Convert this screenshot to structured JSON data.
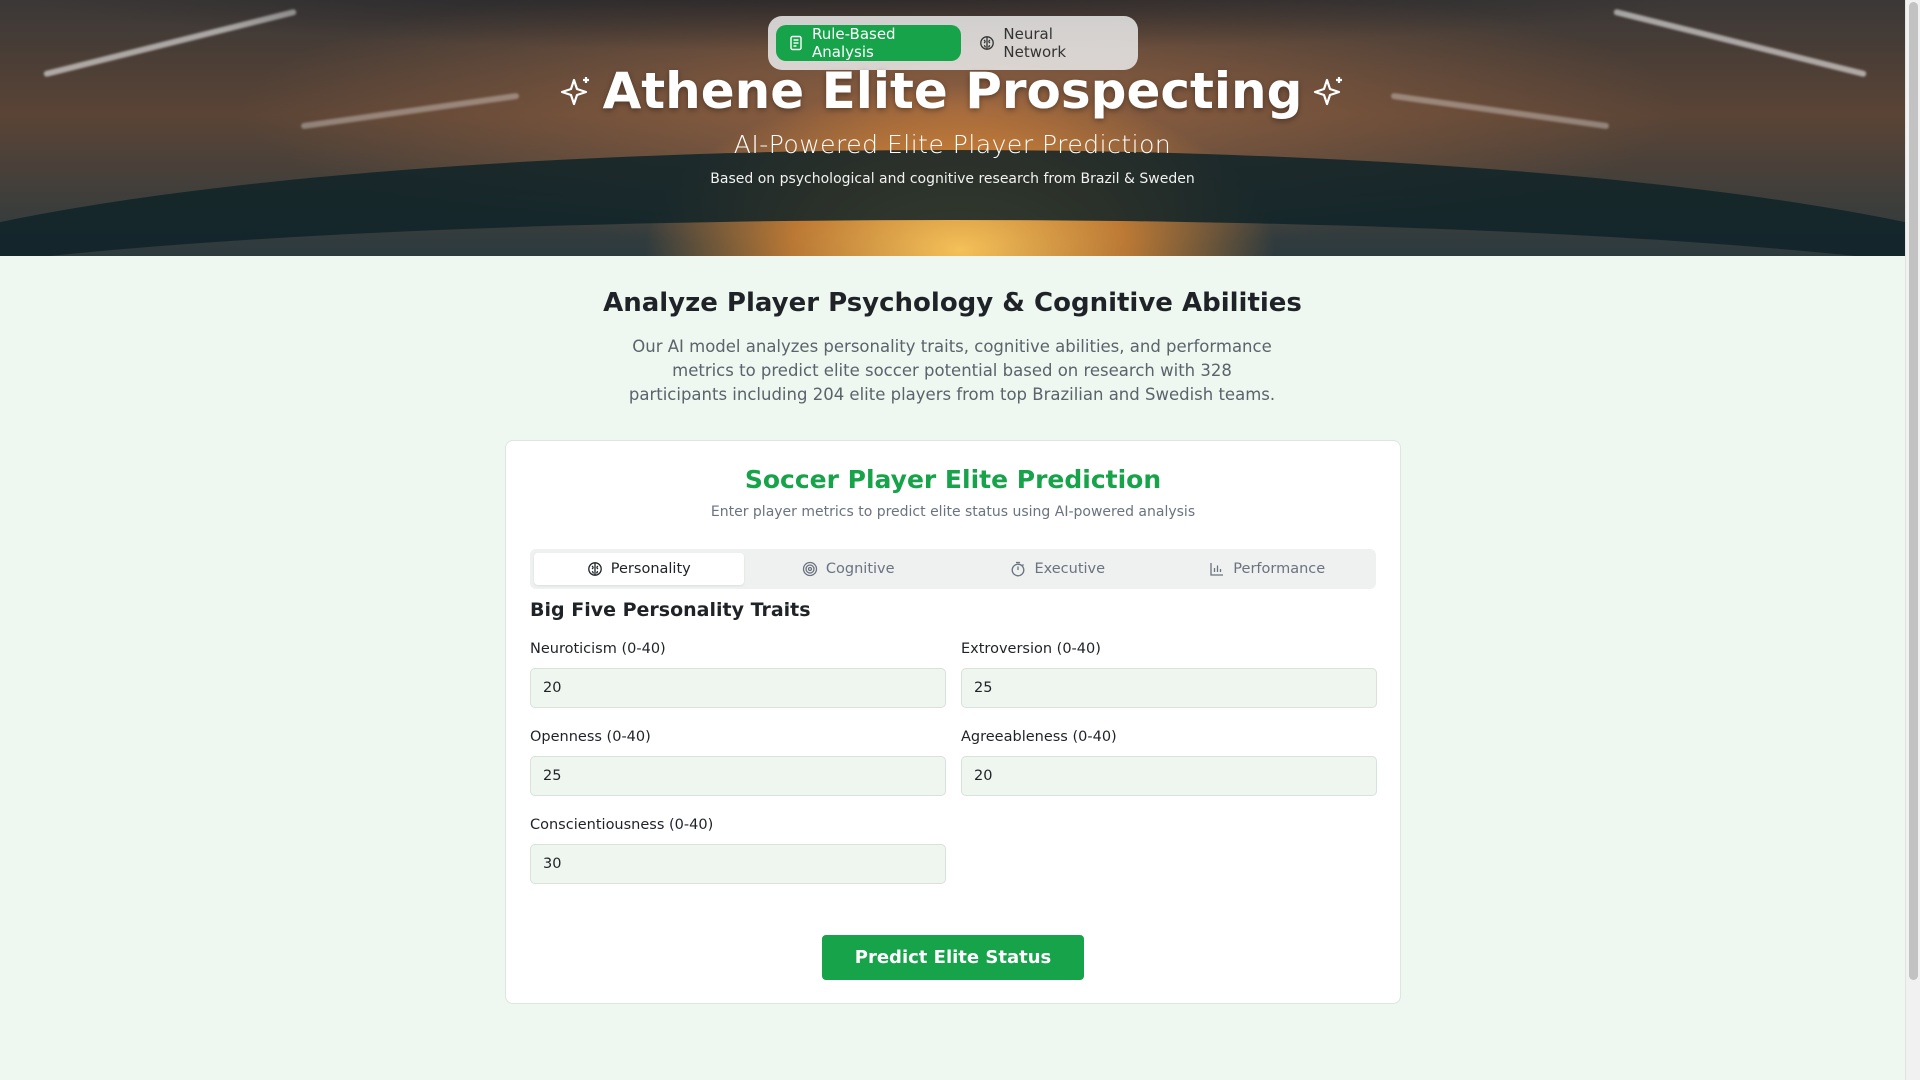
{
  "mode_switch": {
    "options": [
      {
        "label": "Rule-Based Analysis",
        "icon": "document-icon",
        "active": true
      },
      {
        "label": "Neural Network",
        "icon": "brain-icon",
        "active": false
      }
    ]
  },
  "hero": {
    "title": "Athene Elite Prospecting",
    "subtitle": "AI-Powered Elite Player Prediction",
    "note": "Based on psychological and cognitive research from Brazil & Sweden"
  },
  "intro": {
    "title": "Analyze Player Psychology & Cognitive Abilities",
    "description": "Our AI model analyzes personality traits, cognitive abilities, and performance metrics to predict elite soccer potential based on research with 328 participants including 204 elite players from top Brazilian and Swedish teams."
  },
  "card": {
    "title": "Soccer Player Elite Prediction",
    "subtitle": "Enter player metrics to predict elite status using AI-powered analysis",
    "tabs": [
      {
        "label": "Personality",
        "icon": "brain-icon",
        "active": true
      },
      {
        "label": "Cognitive",
        "icon": "target-icon",
        "active": false
      },
      {
        "label": "Executive",
        "icon": "timer-icon",
        "active": false
      },
      {
        "label": "Performance",
        "icon": "bar-chart-icon",
        "active": false
      }
    ],
    "group_title": "Big Five Personality Traits",
    "fields": [
      {
        "label": "Neuroticism (0-40)",
        "value": "20"
      },
      {
        "label": "Extroversion (0-40)",
        "value": "25"
      },
      {
        "label": "Openness (0-40)",
        "value": "25"
      },
      {
        "label": "Agreeableness (0-40)",
        "value": "20"
      },
      {
        "label": "Conscientiousness (0-40)",
        "value": "30"
      }
    ],
    "submit_label": "Predict Elite Status"
  },
  "colors": {
    "accent": "#16a34a",
    "page_background": "#eef7f0",
    "input_background": "#eef6ef"
  }
}
